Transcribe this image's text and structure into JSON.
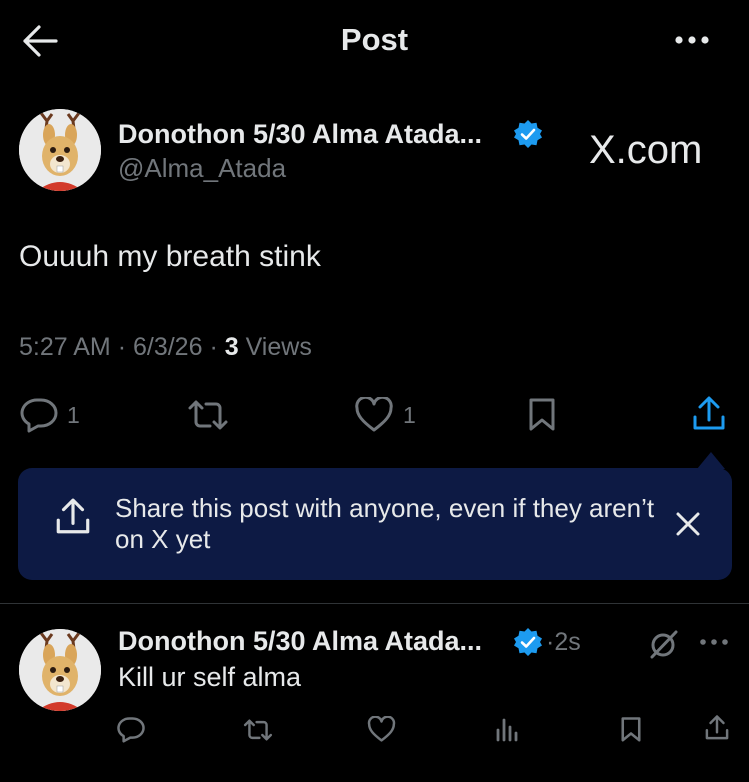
{
  "header": {
    "title": "Post"
  },
  "post": {
    "author_name": "Donothon 5/30 Alma Atada...",
    "handle": "@Alma_Atada",
    "watermark": "X.com",
    "text": "Ouuuh my breath stink",
    "time": "5:27 AM",
    "date": "6/3/26",
    "views_count": "3",
    "views_label": "Views",
    "reply_count": "1",
    "like_count": "1"
  },
  "share_popup": {
    "text": "Share this post with anyone, even if they aren’t on X yet"
  },
  "reply": {
    "author_name": "Donothon 5/30 Alma Atada...",
    "time": "2s",
    "text": "Kill ur self alma"
  },
  "colors": {
    "background": "#000000",
    "verified": "#1d9bf0",
    "popup": "#0d1a44",
    "muted": "#71767b",
    "text": "#e7e9ea"
  },
  "separators": {
    "dot": "·"
  }
}
